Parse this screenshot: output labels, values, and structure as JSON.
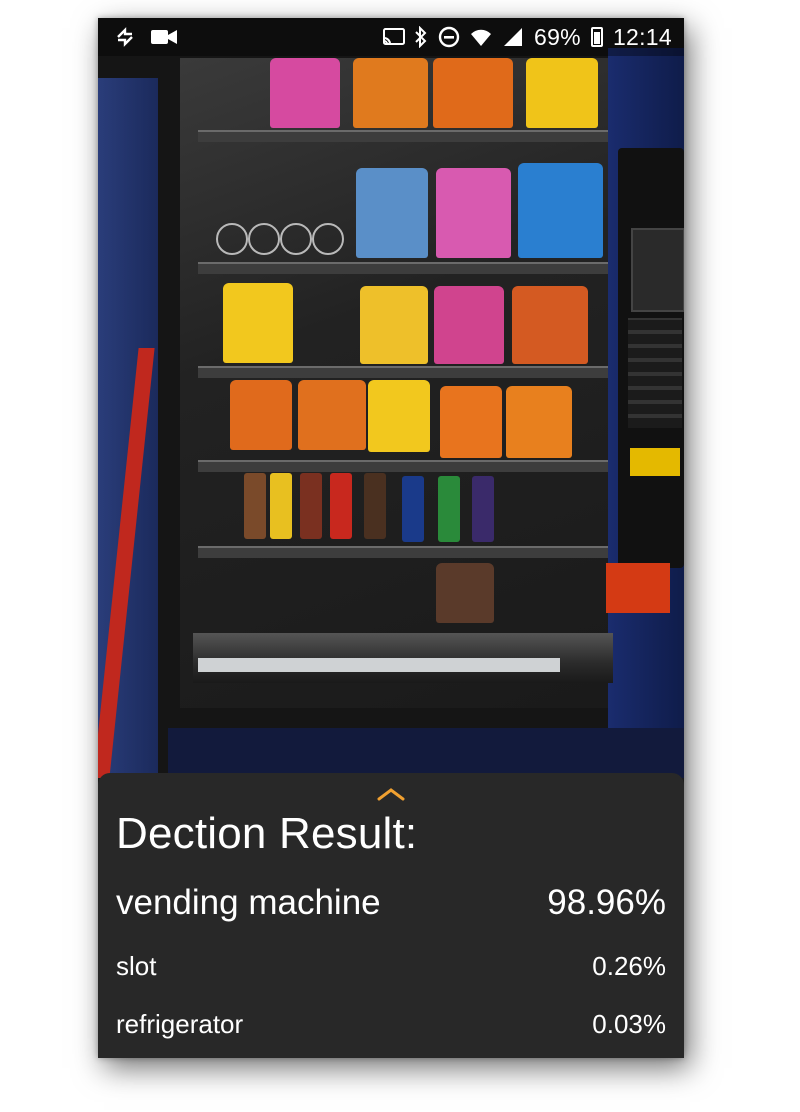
{
  "status_bar": {
    "battery_percent": "69%",
    "time": "12:14",
    "icons": [
      "sync-icon",
      "video-camera-icon",
      "cast-icon",
      "bluetooth-icon",
      "do-not-disturb-icon",
      "wifi-icon",
      "signal-icon",
      "battery-icon"
    ]
  },
  "result_panel": {
    "title": "Dection Result:",
    "results": [
      {
        "label": "vending machine",
        "confidence": "98.96%"
      },
      {
        "label": "slot",
        "confidence": "0.26%"
      },
      {
        "label": "refrigerator",
        "confidence": "0.03%"
      }
    ],
    "accent_color": "#f0a030"
  }
}
